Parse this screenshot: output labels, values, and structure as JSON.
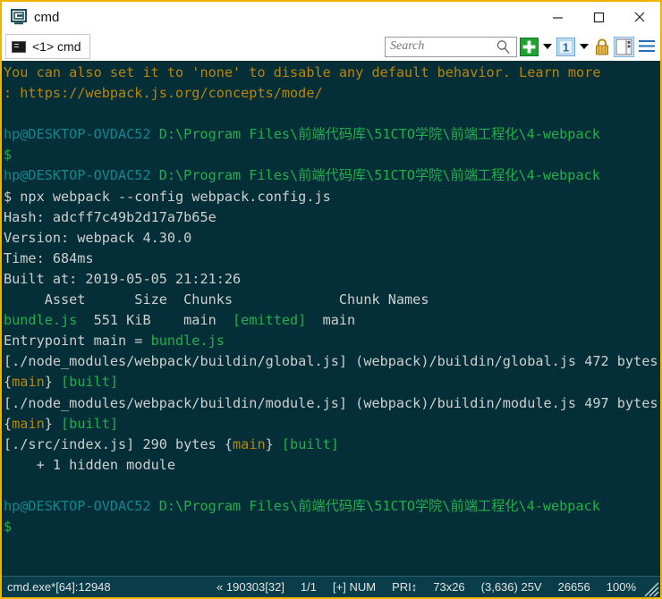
{
  "window": {
    "title": "cmd",
    "border_color": "#f0b400",
    "icon": "conemu-app-icon",
    "controls": {
      "minimize_label": "—",
      "maximize_label": "□",
      "close_label": "✕"
    }
  },
  "tabbar": {
    "tabs": [
      {
        "label": "<1> cmd",
        "icon": "console-window-icon",
        "active": true
      }
    ],
    "search": {
      "placeholder": "Search",
      "value": "",
      "icon": "magnifier-icon"
    },
    "buttons": [
      {
        "name": "new-console-button",
        "icon": "green-plus-icon",
        "label": "+"
      },
      {
        "name": "new-console-dropdown",
        "icon": "chevron-down-icon",
        "label": ""
      },
      {
        "name": "active-console-button",
        "icon": "console-number-icon",
        "label": "1"
      },
      {
        "name": "active-console-dropdown",
        "icon": "chevron-down-icon",
        "label": ""
      },
      {
        "name": "admin-lock-button",
        "icon": "padlock-icon",
        "label": ""
      },
      {
        "name": "split-pane-button",
        "icon": "split-pane-icon",
        "label": ""
      },
      {
        "name": "menu-button",
        "icon": "hamburger-menu-icon",
        "label": ""
      }
    ]
  },
  "terminal": {
    "background": "#042e38",
    "colors": {
      "default": "#c8c8c8",
      "yellow": "#b8860b",
      "green": "#21b04b",
      "teal": "#13878b"
    },
    "lines": [
      {
        "segments": [
          {
            "text": "You can also set it to 'none' to disable any default behavior. Learn more",
            "color": "yellow"
          }
        ]
      },
      {
        "segments": [
          {
            "text": ": https://webpack.js.org/concepts/mode/",
            "color": "yellow"
          }
        ]
      },
      {
        "segments": [
          {
            "text": "",
            "color": "default"
          }
        ]
      },
      {
        "segments": [
          {
            "text": "hp@DESKTOP-OVDAC52",
            "color": "teal"
          },
          {
            "text": " ",
            "color": "default"
          },
          {
            "text": "D:\\Program Files\\前端代码库\\51CTO学院\\前端工程化\\4-webpack",
            "color": "green"
          }
        ]
      },
      {
        "segments": [
          {
            "text": "$",
            "color": "green"
          }
        ]
      },
      {
        "segments": [
          {
            "text": "hp@DESKTOP-OVDAC52",
            "color": "teal"
          },
          {
            "text": " ",
            "color": "default"
          },
          {
            "text": "D:\\Program Files\\前端代码库\\51CTO学院\\前端工程化\\4-webpack",
            "color": "green"
          }
        ]
      },
      {
        "segments": [
          {
            "text": "$ npx webpack --config webpack.config.js",
            "color": "default"
          }
        ]
      },
      {
        "segments": [
          {
            "text": "Hash: adcff7c49b2d17a7b65e",
            "color": "default"
          }
        ]
      },
      {
        "segments": [
          {
            "text": "Version: webpack 4.30.0",
            "color": "default"
          }
        ]
      },
      {
        "segments": [
          {
            "text": "Time: 684ms",
            "color": "default"
          }
        ]
      },
      {
        "segments": [
          {
            "text": "Built at: 2019-05-05 21:21:26",
            "color": "default"
          }
        ]
      },
      {
        "segments": [
          {
            "text": "     Asset      Size  Chunks             Chunk Names",
            "color": "default"
          }
        ]
      },
      {
        "segments": [
          {
            "text": "bundle.js",
            "color": "green"
          },
          {
            "text": "  551 KiB    main  ",
            "color": "default"
          },
          {
            "text": "[emitted]",
            "color": "green"
          },
          {
            "text": "  main",
            "color": "default"
          }
        ]
      },
      {
        "segments": [
          {
            "text": "Entrypoint main = ",
            "color": "default"
          },
          {
            "text": "bundle.js",
            "color": "green"
          }
        ]
      },
      {
        "segments": [
          {
            "text": "[./node_modules/webpack/buildin/global.js] (webpack)/buildin/global.js 472 bytes {",
            "color": "default"
          },
          {
            "text": "main",
            "color": "yellow"
          },
          {
            "text": "} ",
            "color": "default"
          },
          {
            "text": "[built]",
            "color": "green"
          }
        ]
      },
      {
        "segments": [
          {
            "text": "[./node_modules/webpack/buildin/module.js] (webpack)/buildin/module.js 497 bytes {",
            "color": "default"
          },
          {
            "text": "main",
            "color": "yellow"
          },
          {
            "text": "} ",
            "color": "default"
          },
          {
            "text": "[built]",
            "color": "green"
          }
        ]
      },
      {
        "segments": [
          {
            "text": "[./src/index.js] 290 bytes {",
            "color": "default"
          },
          {
            "text": "main",
            "color": "yellow"
          },
          {
            "text": "} ",
            "color": "default"
          },
          {
            "text": "[built]",
            "color": "green"
          }
        ]
      },
      {
        "segments": [
          {
            "text": "    + 1 hidden module",
            "color": "default"
          }
        ]
      },
      {
        "segments": [
          {
            "text": "",
            "color": "default"
          }
        ]
      },
      {
        "segments": [
          {
            "text": "hp@DESKTOP-OVDAC52",
            "color": "teal"
          },
          {
            "text": " ",
            "color": "default"
          },
          {
            "text": "D:\\Program Files\\前端代码库\\51CTO学院\\前端工程化\\4-webpack",
            "color": "green"
          }
        ]
      },
      {
        "segments": [
          {
            "text": "$",
            "color": "green"
          }
        ]
      }
    ]
  },
  "statusbar": {
    "process": "cmd.exe*[64]:12948",
    "segments": [
      {
        "name": "build-version",
        "text": "« 190303[32]"
      },
      {
        "name": "page-indicator",
        "text": "1/1"
      },
      {
        "name": "insert-mode",
        "text": "[+] NUM"
      },
      {
        "name": "priority",
        "text": "PRI↕"
      },
      {
        "name": "console-size",
        "text": "73x26"
      },
      {
        "name": "cursor-position",
        "text": "(3,636) 25V"
      },
      {
        "name": "buffer-count",
        "text": "26656"
      },
      {
        "name": "zoom-level",
        "text": "100%"
      }
    ]
  }
}
